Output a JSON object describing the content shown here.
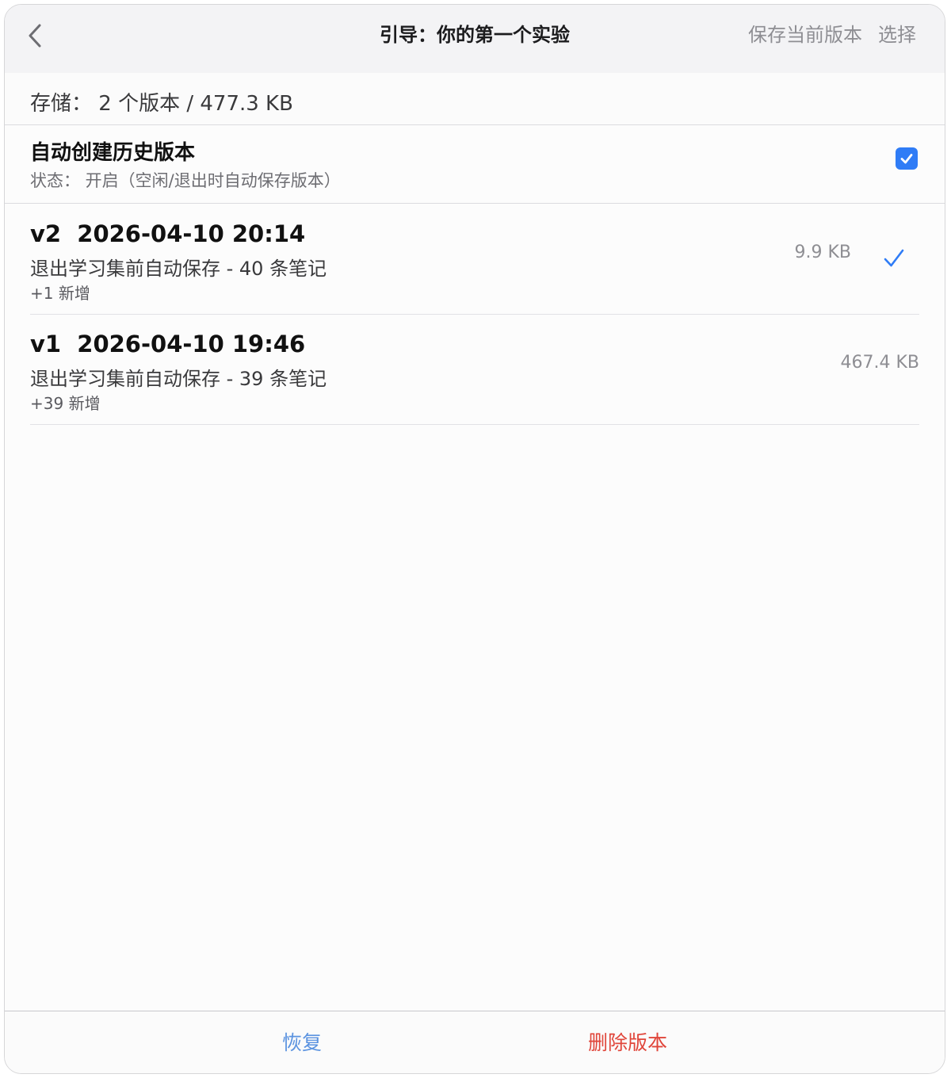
{
  "nav": {
    "back_icon": "chevron-left-icon",
    "title": "引导：你的第一个实验",
    "save_label": "保存当前版本",
    "select_label": "选择"
  },
  "storage": {
    "text": "存储：  2 个版本 / 477.3 KB"
  },
  "auto": {
    "title": "自动创建历史版本",
    "status": "状态：  开启（空闲/退出时自动保存版本）",
    "checked": true
  },
  "versions": [
    {
      "head": "v2  2026-04-10 20:14",
      "desc": "退出学习集前自动保存 - 40 条笔记",
      "change": "+1 新增",
      "size": "9.9 KB",
      "current": true
    },
    {
      "head": "v1  2026-04-10 19:46",
      "desc": "退出学习集前自动保存 - 39 条笔记",
      "change": "+39 新增",
      "size": "467.4 KB",
      "current": false
    }
  ],
  "toolbar": {
    "restore_label": "恢复",
    "delete_label": "删除版本"
  },
  "colors": {
    "accent": "#2f7cf6",
    "restore": "#5b93e0",
    "destructive": "#e0453a",
    "secondary_text": "#8e8e93"
  }
}
